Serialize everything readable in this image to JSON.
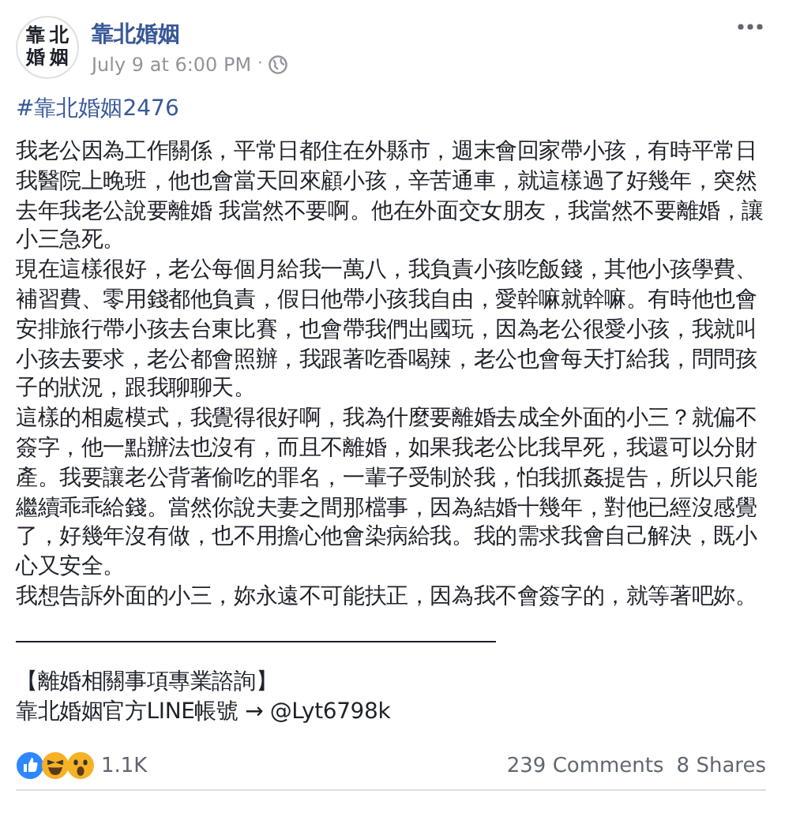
{
  "post": {
    "avatar_text": [
      "靠北",
      "婚姻"
    ],
    "author": "靠北婚姻",
    "timestamp": "July 9 at 6:00 PM",
    "separator": "·",
    "hashtag": "#靠北婚姻2476",
    "paragraphs": [
      "我老公因為工作關係，平常日都住在外縣市，週末會回家帶小孩，有時平常日我醫院上晚班，他也會當天回來顧小孩，辛苦通車，就這樣過了好幾年，突然去年我老公說要離婚 我當然不要啊。他在外面交女朋友，我當然不要離婚，讓小三急死。",
      "現在這樣很好，老公每個月給我一萬八，我負責小孩吃飯錢，其他小孩學費、補習費、零用錢都他負責，假日他帶小孩我自由，愛幹嘛就幹嘛。有時他也會安排旅行帶小孩去台東比賽，也會帶我們出國玩，因為老公很愛小孩，我就叫小孩去要求，老公都會照辦，我跟著吃香喝辣，老公也會每天打給我，問問孩子的狀況，跟我聊聊天。",
      "這樣的相處模式，我覺得很好啊，我為什麼要離婚去成全外面的小三？就偏不簽字，他一點辦法也沒有，而且不離婚，如果我老公比我早死，我還可以分財產。我要讓老公背著偷吃的罪名，一輩子受制於我，怕我抓姦提告，所以只能繼續乖乖給錢。當然你說夫妻之間那檔事，因為結婚十幾年，對他已經沒感覺了，好幾年沒有做，也不用擔心他會染病給我。我的需求我會自己解決，既小心又安全。",
      "我想告訴外面的小三，妳永遠不可能扶正，因為我不會簽字的，就等著吧妳。"
    ],
    "footer_lines": [
      "【離婚相關事項專業諮詢】",
      "靠北婚姻官方LINE帳號 → @Lyt6798k"
    ],
    "reaction_count": "1.1K",
    "comments": "239 Comments",
    "shares": "8 Shares"
  }
}
